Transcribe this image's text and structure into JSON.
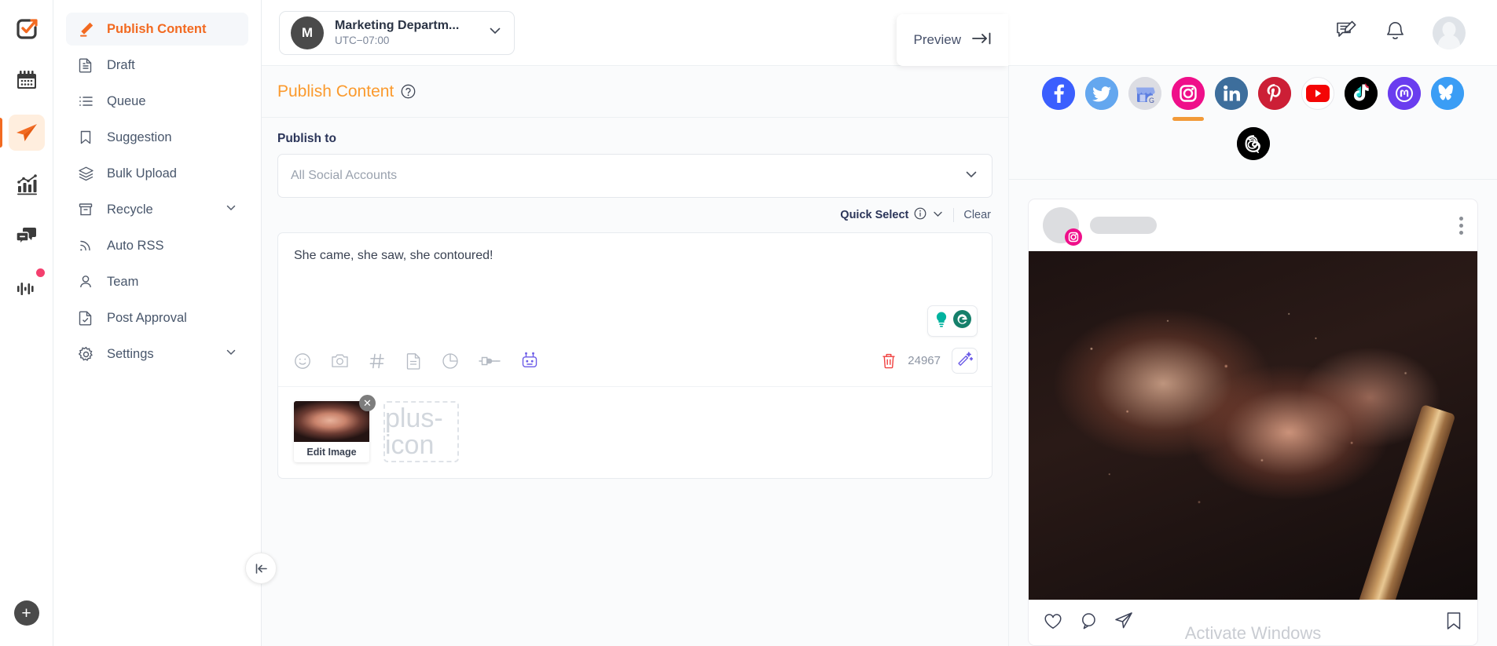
{
  "rail": {
    "items": [
      {
        "name": "brand-logo",
        "icon": "checkbox-arrow-icon"
      },
      {
        "name": "calendar",
        "icon": "calendar-icon"
      },
      {
        "name": "publish",
        "icon": "paper-plane-icon"
      },
      {
        "name": "analytics",
        "icon": "bar-chart-icon"
      },
      {
        "name": "inbox",
        "icon": "chat-bubbles-icon"
      },
      {
        "name": "monitoring",
        "icon": "audio-wave-icon"
      }
    ],
    "add_label": "+"
  },
  "topbar": {
    "workspace": {
      "avatar_initial": "M",
      "name": "Marketing Departm...",
      "timezone": "UTC−07:00"
    },
    "icons": [
      "compose-icon",
      "bell-icon",
      "avatar"
    ]
  },
  "sidebar": {
    "items": [
      {
        "label": "Publish Content",
        "icon": "pencil-icon",
        "active": true,
        "expandable": false
      },
      {
        "label": "Draft",
        "icon": "document-icon",
        "active": false,
        "expandable": false
      },
      {
        "label": "Queue",
        "icon": "list-icon",
        "active": false,
        "expandable": false
      },
      {
        "label": "Suggestion",
        "icon": "bookmark-icon",
        "active": false,
        "expandable": false
      },
      {
        "label": "Bulk Upload",
        "icon": "layers-icon",
        "active": false,
        "expandable": false
      },
      {
        "label": "Recycle",
        "icon": "archive-icon",
        "active": false,
        "expandable": true
      },
      {
        "label": "Auto RSS",
        "icon": "rss-icon",
        "active": false,
        "expandable": false
      },
      {
        "label": "Team",
        "icon": "user-icon",
        "active": false,
        "expandable": false
      },
      {
        "label": "Post Approval",
        "icon": "document-check-icon",
        "active": false,
        "expandable": false
      },
      {
        "label": "Settings",
        "icon": "gear-icon",
        "active": false,
        "expandable": true
      }
    ],
    "collapse_icon": "collapse-left-icon"
  },
  "main": {
    "page_title": "Publish Content",
    "help_icon": "question-circle-icon",
    "preview_label": "Preview",
    "preview_icon": "arrow-right-bar-icon",
    "publish_to_label": "Publish to",
    "publish_to_placeholder": "All Social Accounts",
    "quick_select_label": "Quick Select",
    "quick_select_info_icon": "info-icon",
    "clear_label": "Clear",
    "composer_text": "She came, she saw, she contoured!",
    "grammarly_icons": [
      "lightbulb-icon",
      "grammarly-icon"
    ],
    "toolbar_icons": [
      "emoji-icon",
      "camera-icon",
      "hashtag-icon",
      "document-icon",
      "pie-chart-icon",
      "plug-icon",
      "robot-icon"
    ],
    "delete_icon": "trash-icon",
    "char_count": "24967",
    "ai_wand_icon": "magic-wand-icon",
    "media": {
      "edit_image_label": "Edit Image",
      "remove_icon": "close-icon",
      "add_icon": "plus-icon"
    }
  },
  "preview": {
    "networks_row1": [
      {
        "name": "facebook",
        "color": "#3b5ffe",
        "selected": false
      },
      {
        "name": "twitter",
        "color": "#64a7ef",
        "selected": false
      },
      {
        "name": "google-business",
        "color": "#dcdde3",
        "selected": false
      },
      {
        "name": "instagram",
        "color": "#ef0f8a",
        "selected": true
      },
      {
        "name": "linkedin",
        "color": "#3d6e9c",
        "selected": false
      },
      {
        "name": "pinterest",
        "color": "#cc1f36",
        "selected": false
      },
      {
        "name": "youtube",
        "color": "#ffffff",
        "selected": false
      },
      {
        "name": "tiktok",
        "color": "#000000",
        "selected": false
      },
      {
        "name": "mastodon",
        "color": "#6a3def",
        "selected": false
      },
      {
        "name": "bluesky",
        "color": "#3a9df5",
        "selected": false
      }
    ],
    "networks_row2": [
      {
        "name": "threads",
        "color": "#000000",
        "selected": false
      }
    ],
    "post": {
      "menu_icon": "more-vertical-icon",
      "badge_icon": "instagram-icon",
      "actions": [
        "heart-icon",
        "comment-icon",
        "share-icon",
        "bookmark-icon"
      ]
    },
    "watermark": "Activate Windows"
  }
}
